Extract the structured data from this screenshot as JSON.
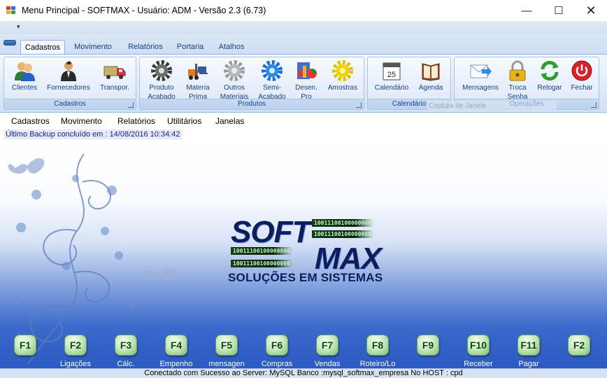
{
  "window": {
    "title": "Menu Principal - SOFTMAX  - Usuário: ADM -  Versão 2.3 (6.73)",
    "minimize_glyph": "—",
    "maximize_glyph": "☐",
    "close_glyph": "✕"
  },
  "qat": {
    "dropdown_glyph": "▾"
  },
  "ribbon": {
    "tabs": [
      "Cadastros",
      "Movimento",
      "Relatórios",
      "Portaria",
      "Atalhos"
    ],
    "active_tab": "Cadastros",
    "groups": [
      {
        "title": "Cadastros",
        "buttons": [
          {
            "label": "Clientes",
            "icon": "users-icon"
          },
          {
            "label": "Fornecedores",
            "icon": "supplier-person-icon"
          },
          {
            "label": "Transpor.",
            "icon": "truck-icon"
          }
        ]
      },
      {
        "title": "Produtos",
        "buttons": [
          {
            "label": "Produto\nAcabado",
            "icon": "gear-dark-icon"
          },
          {
            "label": "Materia\nPrima",
            "icon": "forklift-icon"
          },
          {
            "label": "Outros\nMateriais",
            "icon": "gear-grey-icon"
          },
          {
            "label": "Semi-\nAcabado",
            "icon": "gear-blue-icon"
          },
          {
            "label": "Desen.\nPro",
            "icon": "design-chart-icon"
          },
          {
            "label": "Amostras",
            "icon": "gear-yellow-icon"
          }
        ]
      },
      {
        "title": "Calendário",
        "buttons": [
          {
            "label": "Calendário",
            "icon": "calendar-icon"
          },
          {
            "label": "Agenda",
            "icon": "agenda-book-icon"
          }
        ]
      },
      {
        "title": "Operações",
        "buttons": [
          {
            "label": "Mensagens",
            "icon": "message-arrow-icon"
          },
          {
            "label": "Troca\nSenha",
            "icon": "lock-icon"
          },
          {
            "label": "Relogar",
            "icon": "refresh-icon"
          },
          {
            "label": "Fechar",
            "icon": "power-icon"
          }
        ]
      }
    ],
    "calendar_day": "25",
    "ghost_tooltip": "Captura de Janela"
  },
  "menu": [
    "Cadastros",
    "Movimento",
    "Relatórios",
    "Utilitários",
    "Janelas"
  ],
  "backup_status": "Último Backup concluído em : 14/08/2016 10:34:42",
  "logo": {
    "word1": "SOFT",
    "word2": "MAX",
    "tagline": "SOLUÇÕES EM SISTEMAS",
    "binary_strings": [
      "10011100100000000",
      "10011100100000000",
      "10011100100000000",
      "10011100100000000",
      "10011100100000000"
    ]
  },
  "function_keys": [
    {
      "key": "F1",
      "label": ""
    },
    {
      "key": "F2",
      "label": "Ligações"
    },
    {
      "key": "F3",
      "label": "Cálc."
    },
    {
      "key": "F4",
      "label": "Empenho"
    },
    {
      "key": "F5",
      "label": "mensagen"
    },
    {
      "key": "F6",
      "label": "Compras"
    },
    {
      "key": "F7",
      "label": "Vendas"
    },
    {
      "key": "F8",
      "label": "Roteiro/Lo"
    },
    {
      "key": "F9",
      "label": ""
    },
    {
      "key": "F10",
      "label": "Receber"
    },
    {
      "key": "F11",
      "label": "Pagar"
    },
    {
      "key": "F2",
      "label": ""
    }
  ],
  "status_bar": "Conectado com Sucesso ao Server: MySQL  Banco :mysql_softmax_empresa  No HOST : cpd",
  "colors": {
    "ribbon_text": "#15428b",
    "backup_text": "#1a1aa6",
    "logo_blue": "#0d1e5c",
    "fkey_green": "#0d4a0d"
  }
}
